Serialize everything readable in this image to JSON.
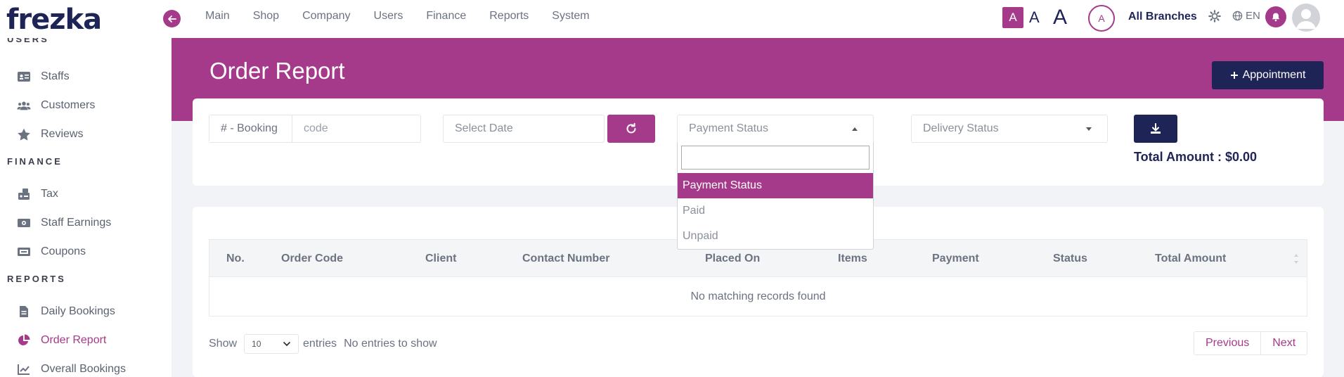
{
  "brand": {
    "logo": "frezka",
    "accent": "#a63a8a",
    "navy": "#1f2457"
  },
  "nav": [
    "Main",
    "Shop",
    "Company",
    "Users",
    "Finance",
    "Reports",
    "System"
  ],
  "topbar": {
    "font_small": "A",
    "font_medium": "A",
    "font_large": "A",
    "branch_avatar": "A",
    "branches": "All Branches",
    "language": "EN"
  },
  "sidebar": {
    "sections": [
      {
        "label": "USERS",
        "items": [
          "Staffs",
          "Customers",
          "Reviews"
        ]
      },
      {
        "label": "FINANCE",
        "items": [
          "Tax",
          "Staff Earnings",
          "Coupons"
        ]
      },
      {
        "label": "REPORTS",
        "items": [
          "Daily Bookings",
          "Order Report",
          "Overall Bookings"
        ]
      }
    ],
    "active": "Order Report"
  },
  "header": {
    "title": "Order Report",
    "appointment_button": "Appointment"
  },
  "filters": {
    "booking_prefix": "# - Booking",
    "booking_placeholder": "code",
    "date_placeholder": "Select Date",
    "payment_status": "Payment Status",
    "delivery_status": "Delivery Status",
    "total_label": "Total Amount :",
    "total_value": "$0.00"
  },
  "dropdown": {
    "search_value": "",
    "options": [
      "Payment Status",
      "Paid",
      "Unpaid"
    ],
    "selected": "Payment Status"
  },
  "table": {
    "columns": [
      "No.",
      "Order Code",
      "Client",
      "Contact Number",
      "Placed On",
      "Items",
      "Payment",
      "Status",
      "Total Amount"
    ],
    "empty_message": "No matching records found",
    "show_label": "Show",
    "page_length": "10",
    "entries_label": "entries",
    "info": "No entries to show",
    "previous": "Previous",
    "next": "Next"
  }
}
